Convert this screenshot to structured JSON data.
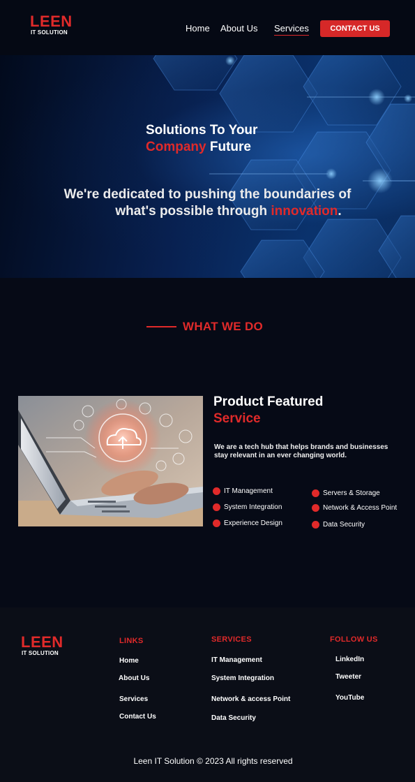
{
  "header": {
    "logo": {
      "name": "LEEN",
      "tagline": "IT SOLUTION"
    },
    "nav": [
      {
        "label": "Home",
        "active": false
      },
      {
        "label": "About Us",
        "active": false
      },
      {
        "label": "Services",
        "active": true
      }
    ],
    "cta_label": "CONTACT US"
  },
  "hero": {
    "title_line1": "Solutions To Your",
    "title_line2_highlight": "Company",
    "title_line2_rest": " Future",
    "subtitle_line1": "We're dedicated to pushing the boundaries of",
    "subtitle_line2_prefix": "what's possible through ",
    "subtitle_line2_highlight": "innovation",
    "subtitle_line2_suffix": "."
  },
  "section": {
    "heading": "WHAT WE DO"
  },
  "feature": {
    "title_line1": "Product Featured",
    "title_line2": "Service",
    "description": "We are a tech hub that helps brands and businesses stay relevant in an ever changing world.",
    "services_left": [
      "IT Management",
      "System Integration",
      "Experience Design"
    ],
    "services_right": [
      "Servers & Storage",
      "Network & Access Point",
      "Data Security"
    ]
  },
  "footer": {
    "logo": {
      "name": "LEEN",
      "tagline": "IT SOLUTION"
    },
    "links_heading": "LINKS",
    "links": [
      "Home",
      "About Us",
      "Services",
      "Contact Us"
    ],
    "services_heading": "SERVICES",
    "services": [
      "IT Management",
      "System Integration",
      "Network & access Point",
      "Data Security"
    ],
    "follow_heading": "FOLLOW US",
    "social": [
      "LinkedIn",
      "Tweeter",
      "YouTube"
    ],
    "copyright": "Leen IT Solution © 2023 All rights reserved"
  },
  "colors": {
    "accent": "#e02a2a",
    "background": "#060a16",
    "footer_bg": "#0b0e17"
  }
}
